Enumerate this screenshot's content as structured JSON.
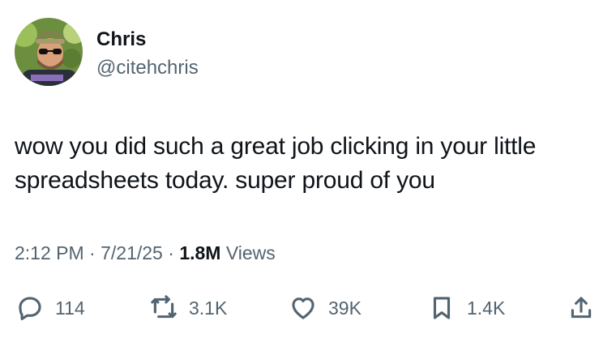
{
  "author": {
    "name": "Chris",
    "handle": "@citehchris"
  },
  "tweet": {
    "text_line1": "wow you did such a great job clicking in your little",
    "text_line2": "spreadsheets today. super proud of you"
  },
  "meta": {
    "time": "2:12 PM",
    "separator1": " · ",
    "date": "7/21/25",
    "separator2": " · ",
    "views_count": "1.8M",
    "views_label": " Views"
  },
  "actions": {
    "reply_count": "114",
    "repost_count": "3.1K",
    "like_count": "39K",
    "bookmark_count": "1.4K"
  },
  "icons": {
    "reply": "reply-icon",
    "repost": "repost-icon",
    "like": "heart-icon",
    "bookmark": "bookmark-icon",
    "share": "share-icon"
  },
  "colors": {
    "text_primary": "#0f1419",
    "text_secondary": "#536471",
    "background": "#ffffff"
  }
}
